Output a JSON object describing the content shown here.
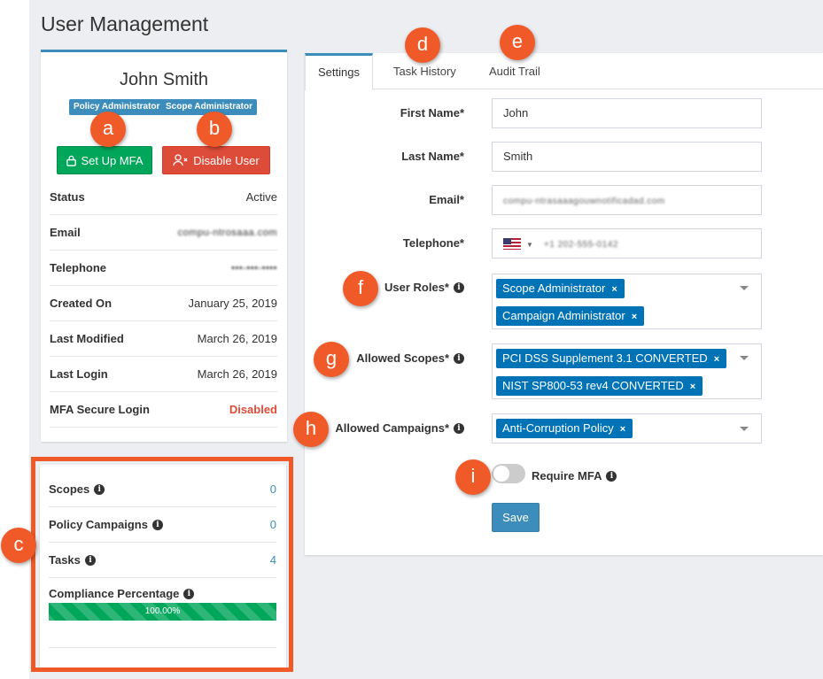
{
  "page_title": "User Management",
  "profile": {
    "name": "John Smith",
    "badges": [
      "Policy Administrator",
      "Scope Administrator"
    ],
    "setup_mfa_label": "Set Up MFA",
    "disable_user_label": "Disable User",
    "rows": [
      {
        "label": "Status",
        "value": "Active"
      },
      {
        "label": "Email",
        "value": "compu-ntrosaaa.com"
      },
      {
        "label": "Telephone",
        "value": "•••-•••-••••"
      },
      {
        "label": "Created On",
        "value": "January 25, 2019"
      },
      {
        "label": "Last Modified",
        "value": "March 26, 2019"
      },
      {
        "label": "Last Login",
        "value": "March 26, 2019"
      },
      {
        "label": "MFA Secure Login",
        "value": "Disabled"
      }
    ]
  },
  "stats": {
    "rows": [
      {
        "label": "Scopes",
        "value": "0"
      },
      {
        "label": "Policy Campaigns",
        "value": "0"
      },
      {
        "label": "Tasks",
        "value": "4"
      }
    ],
    "compliance_label": "Compliance Percentage",
    "compliance_value": "100.00%",
    "compliance_fraction": 1.0
  },
  "tabs": [
    "Settings",
    "Task History",
    "Audit Trail"
  ],
  "form": {
    "first_name_label": "First Name*",
    "first_name_value": "John",
    "last_name_label": "Last Name*",
    "last_name_value": "Smith",
    "email_label": "Email*",
    "email_value": "compu-ntrasaaagouwnotificadad.com",
    "telephone_label": "Telephone*",
    "telephone_value": "+1 202-555-0142",
    "user_roles_label": "User Roles*",
    "user_roles": [
      "Scope Administrator",
      "Campaign Administrator"
    ],
    "allowed_scopes_label": "Allowed Scopes*",
    "allowed_scopes": [
      "PCI DSS Supplement 3.1 CONVERTED",
      "NIST SP800-53 rev4 CONVERTED"
    ],
    "allowed_campaigns_label": "Allowed Campaigns*",
    "allowed_campaigns": [
      "Anti-Corruption Policy"
    ],
    "require_mfa_label": "Require MFA",
    "require_mfa_on": false,
    "save_label": "Save"
  },
  "callouts": [
    "a",
    "b",
    "c",
    "d",
    "e",
    "f",
    "g",
    "h",
    "i"
  ],
  "colors": {
    "primary": "#3c8dbc",
    "success": "#00a65a",
    "danger": "#dd4b39",
    "chip": "#0073b7",
    "callout": "#ef5a28"
  }
}
